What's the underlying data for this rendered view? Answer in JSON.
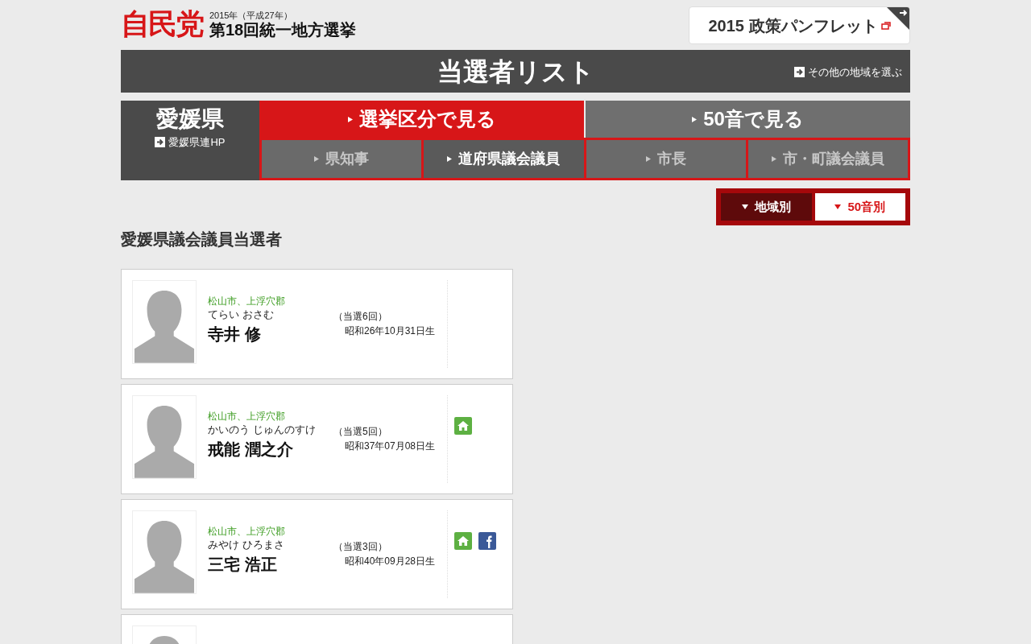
{
  "header": {
    "logo": "自民党",
    "year": "2015年（平成27年）",
    "election": "第18回統一地方選挙",
    "pamphlet": "2015 政策パンフレット"
  },
  "title_bar": {
    "title": "当選者リスト",
    "other_region": "その他の地域を選ぶ"
  },
  "prefecture": {
    "name": "愛媛県",
    "link": "愛媛県連HP"
  },
  "main_tabs": [
    {
      "label": "選挙区分で見る",
      "selected": true
    },
    {
      "label": "50音で見る",
      "selected": false
    }
  ],
  "sub_tabs": [
    {
      "label": "県知事",
      "selected": false,
      "disabled": true
    },
    {
      "label": "道府県議会議員",
      "selected": true,
      "disabled": false
    },
    {
      "label": "市長",
      "selected": false,
      "disabled": true
    },
    {
      "label": "市・町議会議員",
      "selected": false,
      "disabled": true
    }
  ],
  "sort": [
    {
      "label": "地域別",
      "selected": true
    },
    {
      "label": "50音別",
      "selected": false
    }
  ],
  "heading": "愛媛県議会議員当選者",
  "winners": [
    {
      "region": "松山市、上浮穴郡",
      "kana": "てらい おさむ",
      "name": "寺井 修",
      "terms": "（当選6回）",
      "born": "昭和26年10月31日生",
      "home": false,
      "facebook": false
    },
    {
      "region": "松山市、上浮穴郡",
      "kana": "かいのう じゅんのすけ",
      "name": "戒能 潤之介",
      "terms": "（当選5回）",
      "born": "昭和37年07月08日生",
      "home": true,
      "facebook": false
    },
    {
      "region": "松山市、上浮穴郡",
      "kana": "みやけ ひろまさ",
      "name": "三宅 浩正",
      "terms": "（当選3回）",
      "born": "昭和40年09月28日生",
      "home": true,
      "facebook": true
    }
  ],
  "more_below": true
}
